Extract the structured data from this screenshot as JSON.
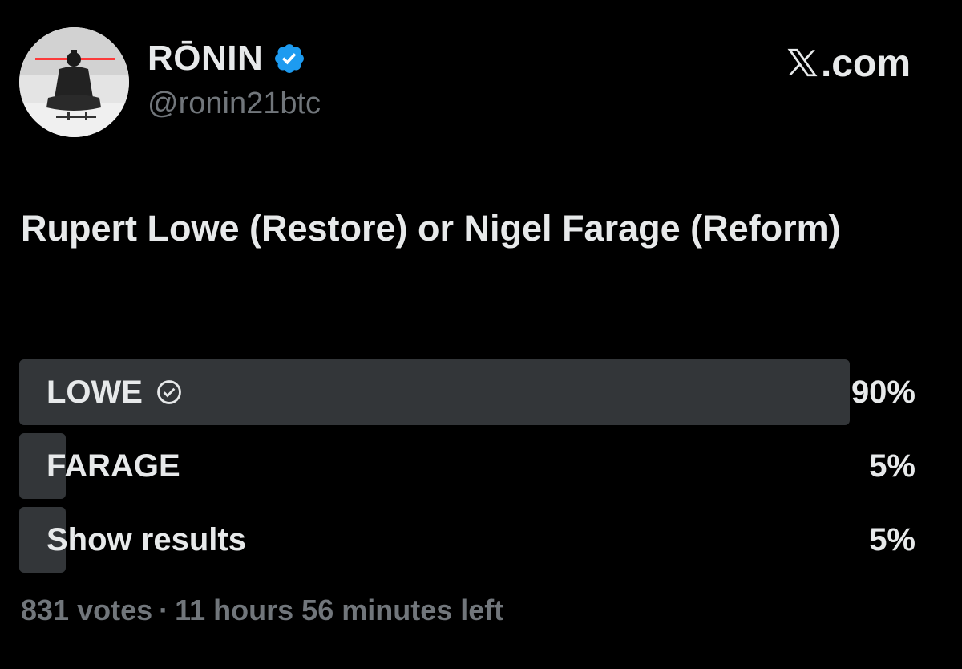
{
  "author": {
    "display_name": "RŌNIN",
    "handle": "@ronin21btc",
    "verified": true,
    "avatar_icon": "avatar-meditating-samurai",
    "verified_color": "#1d9bf0"
  },
  "source": {
    "label": ".com",
    "logo_icon": "x-logo-icon"
  },
  "post": {
    "text": "Rupert Lowe (Restore) or Nigel Farage (Reform)"
  },
  "poll": {
    "options": [
      {
        "label": "LOWE",
        "percent_text": "90%",
        "percent": 90,
        "selected": true
      },
      {
        "label": "FARAGE",
        "percent_text": "5%",
        "percent": 5,
        "selected": false
      },
      {
        "label": "Show results",
        "percent_text": "5%",
        "percent": 5,
        "selected": false
      }
    ],
    "votes": "831 votes",
    "separator": "·",
    "time_left": "11 hours 56 minutes left",
    "fill_color": "#333639"
  }
}
